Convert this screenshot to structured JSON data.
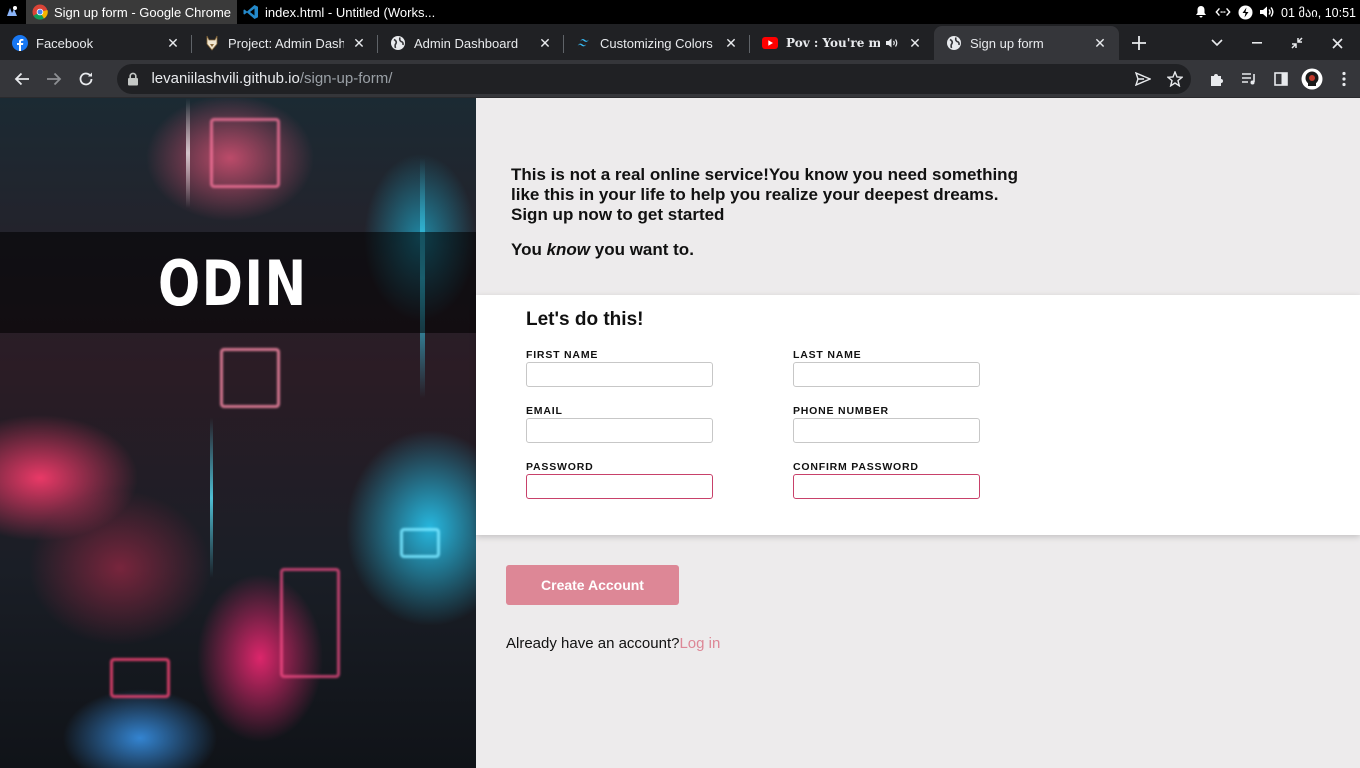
{
  "os_bar": {
    "items": [
      {
        "label": "Sign up form - Google Chrome",
        "icon": "chrome-icon",
        "active": true
      },
      {
        "label": "index.html - Untitled (Works...",
        "icon": "vscode-icon",
        "active": false
      }
    ],
    "clock": "01 მაი, 10:51"
  },
  "tabs": [
    {
      "label": "Facebook",
      "icon": "facebook-icon"
    },
    {
      "label": "Project: Admin Dashb",
      "icon": "odin-icon"
    },
    {
      "label": "Admin Dashboard",
      "icon": "globe-icon"
    },
    {
      "label": "Customizing Colors - T",
      "icon": "tailwind-icon"
    },
    {
      "label": "Pov : You're misun",
      "icon": "youtube-icon"
    },
    {
      "label": "Sign up form",
      "icon": "globe-icon",
      "active": true
    }
  ],
  "address_bar": {
    "host": "levaniilashvili.github.io",
    "path": "/sign-up-form/"
  },
  "hero": {
    "logo_text": "ODIN"
  },
  "intro": {
    "line1": "This is not a real online service!You know you need something like this in your life to help you realize your deepest dreams. Sign up now to get started",
    "line2_prefix": "You ",
    "line2_em": "know",
    "line2_suffix": " you want to."
  },
  "form": {
    "title": "Let's do this!",
    "fields": [
      {
        "label": "FIRST NAME",
        "value": ""
      },
      {
        "label": "LAST NAME",
        "value": ""
      },
      {
        "label": "EMAIL",
        "value": ""
      },
      {
        "label": "PHONE NUMBER",
        "value": ""
      },
      {
        "label": "PASSWORD",
        "value": ""
      },
      {
        "label": "CONFIRM PASSWORD",
        "value": ""
      }
    ]
  },
  "actions": {
    "create_label": "Create Account",
    "login_prompt": "Already have an account?",
    "login_link": "Log in"
  },
  "colors": {
    "accent": "#dd8796",
    "invalid_border": "#c8416a",
    "page_bg": "#edebec"
  }
}
